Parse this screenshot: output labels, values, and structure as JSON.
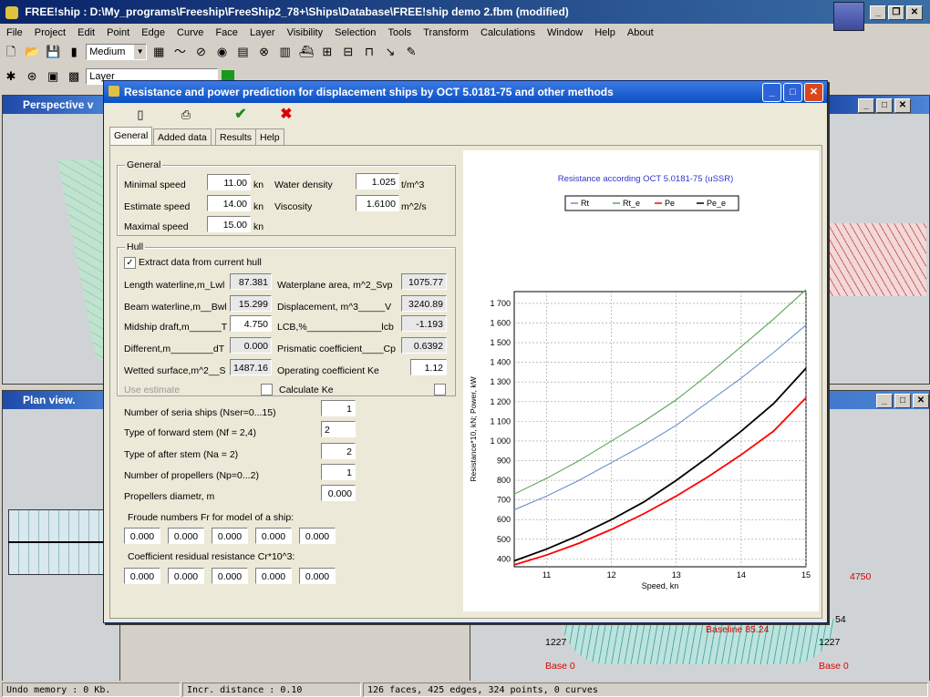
{
  "app": {
    "title": "FREE!ship  : D:\\My_programs\\Freeship\\FreeShip2_78+\\Ships\\Database\\FREE!ship demo 2.fbm (modified)"
  },
  "menu": [
    "File",
    "Project",
    "Edit",
    "Point",
    "Edge",
    "Curve",
    "Face",
    "Layer",
    "Visibility",
    "Selection",
    "Tools",
    "Transform",
    "Calculations",
    "Window",
    "Help",
    "About"
  ],
  "toolbar": {
    "precision_value": "Medium",
    "layer_value": "Layer"
  },
  "viewports": {
    "perspective_title": "Perspective v",
    "plan_title": "Plan view.",
    "right_labels": {
      "draft": "4750",
      "base_left": "Base 0",
      "base_right": "Base 0",
      "baseline_label": "Baseline 85.24",
      "numbers": [
        "1227",
        "1227",
        "54"
      ]
    }
  },
  "dialog": {
    "title": "Resistance and power prediction for displacement ships by OCT 5.0181-75 and other methods",
    "tabs": [
      "General",
      "Added data",
      "Results",
      "Help"
    ],
    "active_tab": "General",
    "general_group": {
      "label": "General",
      "min_speed_label": "Minimal  speed",
      "min_speed_value": "11.00",
      "min_speed_unit": "kn",
      "est_speed_label": "Estimate speed",
      "est_speed_value": "14.00",
      "est_speed_unit": "kn",
      "max_speed_label": "Maximal  speed",
      "max_speed_value": "15.00",
      "max_speed_unit": "kn",
      "water_density_label": "Water density",
      "water_density_value": "1.025",
      "water_density_unit": "t/m^3",
      "viscosity_label": "Viscosity",
      "viscosity_value": "1.6100",
      "viscosity_unit": "m^2/s"
    },
    "hull_group": {
      "label": "Hull",
      "extract_label": "Extract data from current hull",
      "extract_checked": true,
      "lwl_label": "Length waterline,m_Lwl",
      "lwl_value": "87.381",
      "bwl_label": "Beam waterline,m__Bwl",
      "bwl_value": "15.299",
      "t_label": "Midship draft,m______T",
      "t_value": "4.750",
      "dt_label": "Different,m________dT",
      "dt_value": "0.000",
      "s_label": "Wetted surface,m^2__S",
      "s_value": "1487.16",
      "svp_label": "Waterplane area, m^2_Svp",
      "svp_value": "1075.77",
      "v_label": "Displacement, m^3_____V",
      "v_value": "3240.89",
      "lcb_label": "LCB,%______________lcb",
      "lcb_value": "-1.193",
      "cp_label": "Prismatic coefficient____Cp",
      "cp_value": "0.6392",
      "ke_label": "Operating coefficient Ke",
      "ke_value": "1.12",
      "use_estimate_label": "Use estimate",
      "calc_ke_label": "Calculate Ke"
    },
    "params": {
      "nser_label": "Number of seria ships  (Nser=0...15)",
      "nser_value": "1",
      "nf_label": "Type of forward stem   (Nf = 2,4)",
      "nf_value": "2",
      "na_label": "Type of after stem   (Na = 2)",
      "na_value": "2",
      "np_label": "Number of propellers  (Np=0...2)",
      "np_value": "1",
      "diam_label": "Propellers diametr, m",
      "diam_value": "0.000",
      "froude_label": "Froude numbers Fr for model of a ship:",
      "froude_values": [
        "0.000",
        "0.000",
        "0.000",
        "0.000",
        "0.000"
      ],
      "cr_label": "Coefficient residual resistance Cr*10^3:",
      "cr_values": [
        "0.000",
        "0.000",
        "0.000",
        "0.000",
        "0.000"
      ]
    }
  },
  "chart_data": {
    "type": "line",
    "title": "Resistance according OCT 5.0181-75 (uSSR)",
    "xlabel": "Speed, kn",
    "ylabel": "Resistance*10, kN;  Power, kW",
    "xlim": [
      10.5,
      15
    ],
    "ylim": [
      360,
      1760
    ],
    "xticks": [
      11,
      12,
      13,
      14,
      15
    ],
    "yticks": [
      400,
      500,
      600,
      700,
      800,
      900,
      1000,
      1100,
      1200,
      1300,
      1400,
      1500,
      1600,
      1700
    ],
    "legend_position": "top",
    "x": [
      10.5,
      11,
      11.5,
      12,
      12.5,
      13,
      13.5,
      14,
      14.5,
      15
    ],
    "series": [
      {
        "name": "Rt",
        "color": "#6a8fd0",
        "values": [
          650,
          720,
          800,
          890,
          980,
          1080,
          1200,
          1320,
          1450,
          1590
        ]
      },
      {
        "name": "Rt_e",
        "color": "#5aa55a",
        "values": [
          730,
          810,
          900,
          1000,
          1100,
          1210,
          1340,
          1480,
          1620,
          1770
        ]
      },
      {
        "name": "Pe",
        "color": "#ff0000",
        "values": [
          370,
          420,
          480,
          550,
          630,
          720,
          820,
          930,
          1050,
          1220
        ]
      },
      {
        "name": "Pe_e",
        "color": "#000000",
        "values": [
          390,
          450,
          520,
          600,
          690,
          800,
          920,
          1050,
          1190,
          1370
        ]
      }
    ]
  },
  "status": {
    "undo": "Undo memory : 0 Kb.",
    "incr": "Incr. distance : 0.10",
    "counts": "126 faces, 425 edges, 324 points, 0 curves"
  }
}
